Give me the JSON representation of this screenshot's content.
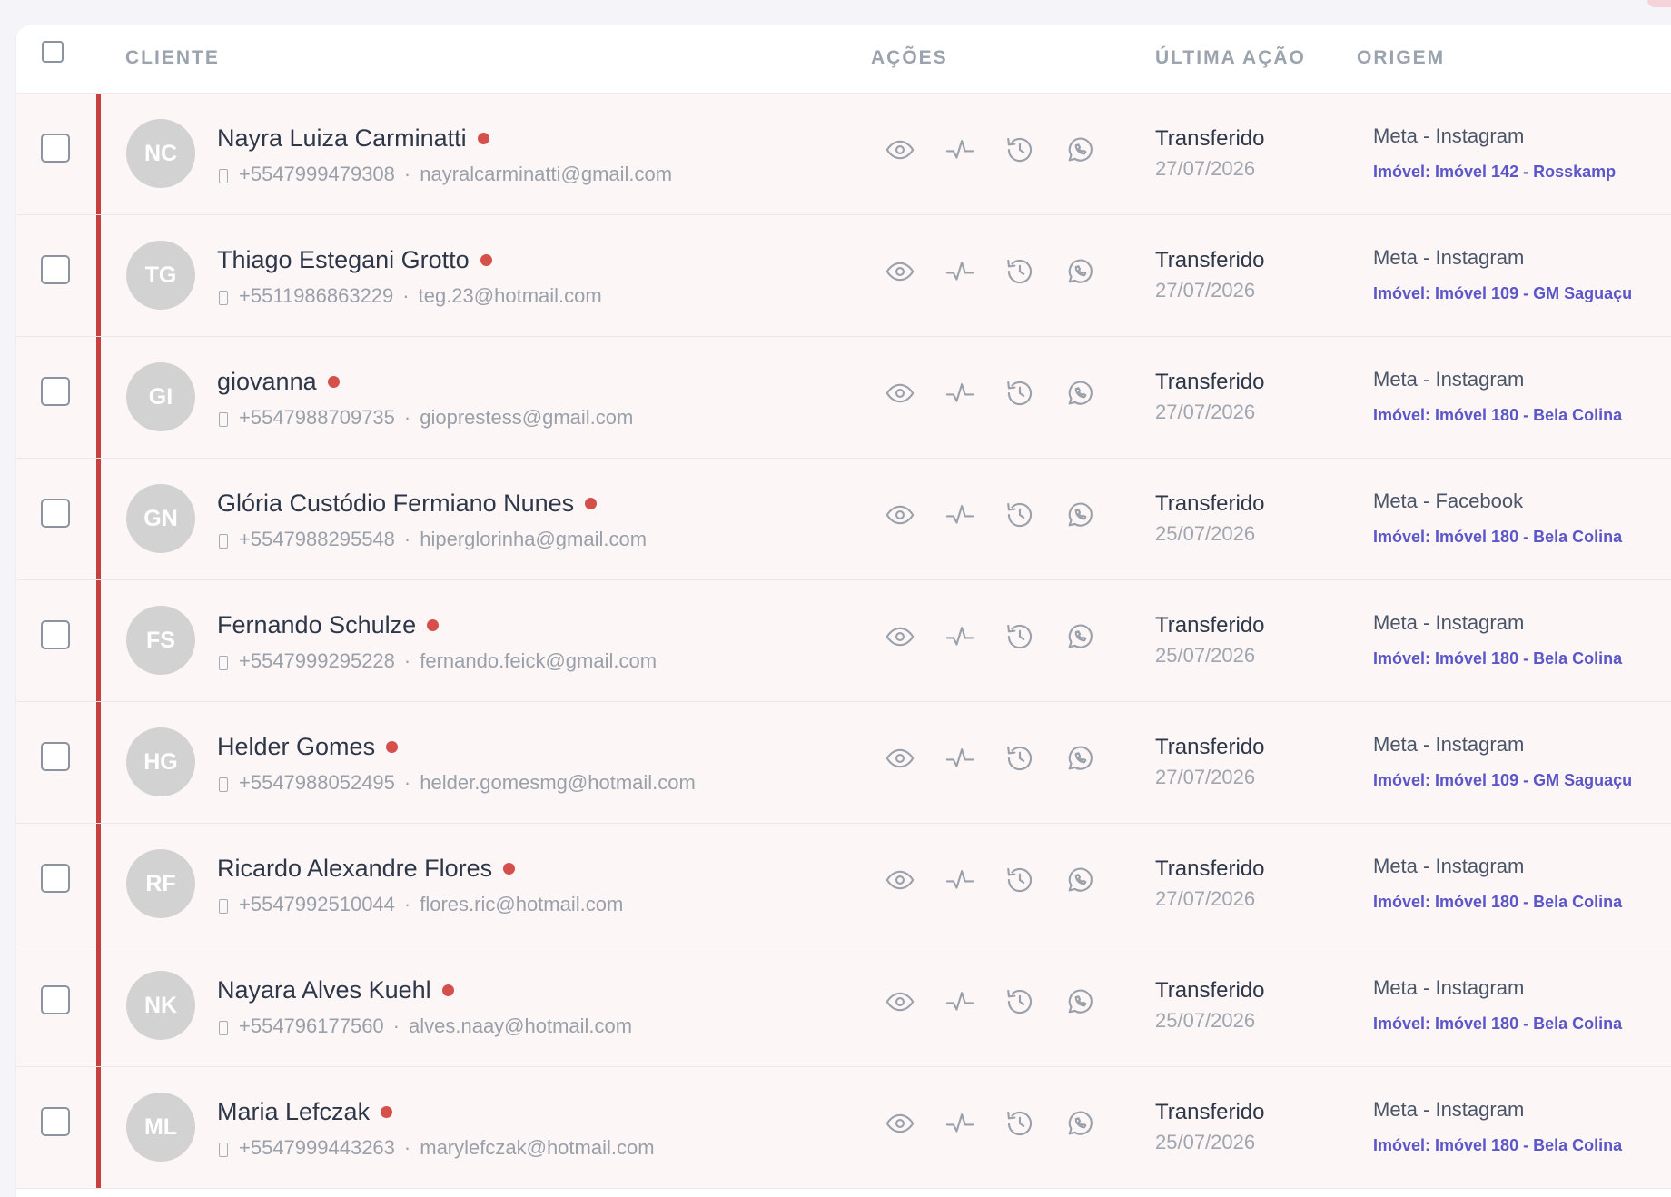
{
  "header": {
    "select_all": "",
    "columns": {
      "client": "CLIENTE",
      "actions": "AÇÕES",
      "last_action": "ÚLTIMA AÇÃO",
      "origin": "ORIGEM"
    }
  },
  "colors": {
    "accent": "#c83f3f",
    "status_dot": "#d5504b",
    "link": "#5b57c8",
    "row_bg": "#fdf6f6"
  },
  "action_icons": [
    "eye-icon",
    "activity-icon",
    "history-icon",
    "whatsapp-icon"
  ],
  "rows": [
    {
      "initials": "NC",
      "name": "Nayra Luiza Carminatti",
      "phone": "+5547999479308",
      "email": "nayralcarminatti@gmail.com",
      "status": "Transferido",
      "date": "27/07/2026",
      "origin": "Meta - Instagram",
      "property": "Imóvel: Imóvel 142 - Rosskamp"
    },
    {
      "initials": "TG",
      "name": "Thiago Estegani Grotto",
      "phone": "+5511986863229",
      "email": "teg.23@hotmail.com",
      "status": "Transferido",
      "date": "27/07/2026",
      "origin": "Meta - Instagram",
      "property": "Imóvel: Imóvel 109 - GM Saguaçu"
    },
    {
      "initials": "GI",
      "name": "giovanna",
      "phone": "+5547988709735",
      "email": "gioprestess@gmail.com",
      "status": "Transferido",
      "date": "27/07/2026",
      "origin": "Meta - Instagram",
      "property": "Imóvel: Imóvel 180 - Bela Colina"
    },
    {
      "initials": "GN",
      "name": "Glória Custódio Fermiano Nunes",
      "phone": "+5547988295548",
      "email": "hiperglorinha@gmail.com",
      "status": "Transferido",
      "date": "25/07/2026",
      "origin": "Meta - Facebook",
      "property": "Imóvel: Imóvel 180 - Bela Colina"
    },
    {
      "initials": "FS",
      "name": "Fernando Schulze",
      "phone": "+5547999295228",
      "email": "fernando.feick@gmail.com",
      "status": "Transferido",
      "date": "25/07/2026",
      "origin": "Meta - Instagram",
      "property": "Imóvel: Imóvel 180 - Bela Colina"
    },
    {
      "initials": "HG",
      "name": "Helder Gomes",
      "phone": "+5547988052495",
      "email": "helder.gomesmg@hotmail.com",
      "status": "Transferido",
      "date": "27/07/2026",
      "origin": "Meta - Instagram",
      "property": "Imóvel: Imóvel 109 - GM Saguaçu"
    },
    {
      "initials": "RF",
      "name": "Ricardo Alexandre Flores",
      "phone": "+5547992510044",
      "email": "flores.ric@hotmail.com",
      "status": "Transferido",
      "date": "27/07/2026",
      "origin": "Meta - Instagram",
      "property": "Imóvel: Imóvel 180 - Bela Colina"
    },
    {
      "initials": "NK",
      "name": "Nayara Alves Kuehl",
      "phone": "+554796177560",
      "email": "alves.naay@hotmail.com",
      "status": "Transferido",
      "date": "25/07/2026",
      "origin": "Meta - Instagram",
      "property": "Imóvel: Imóvel 180 - Bela Colina"
    },
    {
      "initials": "ML",
      "name": "Maria Lefczak",
      "phone": "+5547999443263",
      "email": "marylefczak@hotmail.com",
      "status": "Transferido",
      "date": "25/07/2026",
      "origin": "Meta - Instagram",
      "property": "Imóvel: Imóvel 180 - Bela Colina"
    }
  ]
}
